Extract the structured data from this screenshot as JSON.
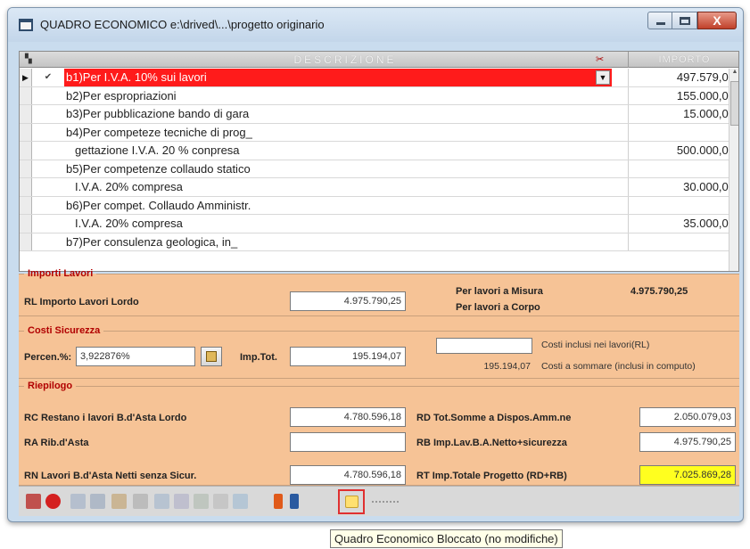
{
  "window": {
    "title": "QUADRO ECONOMICO  e:\\drived\\...\\progetto originario",
    "close_glyph": "X"
  },
  "grid": {
    "columns": {
      "description": "DESCRIZIONE",
      "amount": "IMPORTO"
    },
    "rows": [
      {
        "desc": "b1)Per I.V.A. 10% sui lavori",
        "amount": "497.579,03",
        "active": true
      },
      {
        "desc": "b2)Per espropriazioni",
        "amount": "155.000,00"
      },
      {
        "desc": "b3)Per pubblicazione bando di gara",
        "amount": "15.000,00"
      },
      {
        "desc": "b4)Per competeze tecniche di prog_",
        "amount": ""
      },
      {
        "desc": "gettazione I.V.A. 20 % conpresa",
        "amount": "500.000,00",
        "indent": true
      },
      {
        "desc": "b5)Per competenze collaudo statico",
        "amount": ""
      },
      {
        "desc": "I.V.A. 20% compresa",
        "amount": "30.000,00",
        "indent": true
      },
      {
        "desc": "b6)Per compet. Collaudo Amministr.",
        "amount": ""
      },
      {
        "desc": "I.V.A. 20% compresa",
        "amount": "35.000,00",
        "indent": true
      },
      {
        "desc": "b7)Per consulenza  geologica, in_",
        "amount": ""
      }
    ]
  },
  "importi": {
    "legend": "Importi Lavori",
    "rl_label": "RL  Importo  Lavori  Lordo",
    "rl_value": "4.975.790,25",
    "misura_label": "Per lavori a Misura",
    "misura_value": "4.975.790,25",
    "corpo_label": "Per lavori a Corpo"
  },
  "sicurezza": {
    "legend": "Costi Sicurezza",
    "percen_label": "Percen.%:",
    "percen_value": "3,922876%",
    "imptot_label": "Imp.Tot.",
    "imptot_value": "195.194,07",
    "inclusi_value": "",
    "inclusi_label": "Costi inclusi nei lavori(RL)",
    "sommare_value": "195.194,07",
    "sommare_label": "Costi a sommare (inclusi in computo)"
  },
  "riepilogo": {
    "legend": "Riepilogo",
    "rc_label": "RC  Restano i lavori B.d'Asta Lordo",
    "rc_value": "4.780.596,18",
    "rd_label": "RD  Tot.Somme a Dispos.Amm.ne",
    "rd_value": "2.050.079,03",
    "ra_label": "RA  Rib.d'Asta",
    "ra_value": "",
    "rb_label": "RB  Imp.Lav.B.A.Netto+sicurezza",
    "rb_value": "4.975.790,25",
    "rn_label": "RN  Lavori B.d'Asta Netti senza Sicur.",
    "rn_value": "4.780.596,18",
    "rt_label": "RT  Imp.Totale Progetto (RD+RB)",
    "rt_value": "7.025.869,28"
  },
  "tooltip": "Quadro Economico Bloccato (no modifiche)",
  "colors": {
    "active_row": "#ff1b1b",
    "panel_bg": "#f6c396",
    "legend_text": "#b10000",
    "highlight_total": "#ffff1f"
  },
  "toolbar_icons": [
    "print-icon",
    "stop-icon",
    "edit-icon",
    "save-icon",
    "filter-icon",
    "tools-icon",
    "grid-icon",
    "delete-icon",
    "copy-icon",
    "undo-icon",
    "arrow-up-icon",
    "arrow-down-icon",
    "lock-icon"
  ]
}
